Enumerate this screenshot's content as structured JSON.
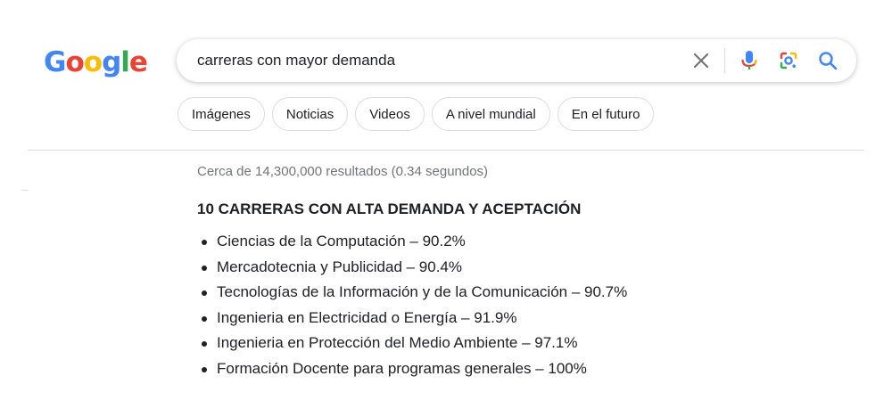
{
  "logo": {
    "letters": [
      {
        "char": "G",
        "color": "#4285F4"
      },
      {
        "char": "o",
        "color": "#EA4335"
      },
      {
        "char": "o",
        "color": "#FBBC05"
      },
      {
        "char": "g",
        "color": "#4285F4"
      },
      {
        "char": "l",
        "color": "#34A853"
      },
      {
        "char": "e",
        "color": "#EA4335"
      }
    ]
  },
  "search": {
    "query": "carreras con mayor demanda",
    "icons": {
      "clear": "close-icon",
      "voice": "microphone-icon",
      "lens": "google-lens-icon",
      "submit": "search-icon"
    }
  },
  "filters": {
    "chips": [
      "Imágenes",
      "Noticias",
      "Videos",
      "A nivel mundial",
      "En el futuro"
    ]
  },
  "results": {
    "stats": "Cerca de 14,300,000 resultados (0.34 segundos)",
    "snippet": {
      "title": "10 CARRERAS CON ALTA DEMANDA Y ACEPTACIÓN",
      "items": [
        "Ciencias de la Computación – 90.2%",
        "Mercadotecnia y Publicidad – 90.4%",
        "Tecnologías de la Información y de la Comunicación – 90.7%",
        "Ingenieria en Electricidad o Energía – 91.9%",
        "Ingenieria en Protección del Medio Ambiente – 97.1%",
        "Formación Docente para programas generales – 100%"
      ]
    }
  },
  "colors": {
    "google_blue": "#4285F4",
    "google_red": "#EA4335",
    "google_yellow": "#FBBC05",
    "google_green": "#34A853",
    "text": "#202124",
    "secondary_text": "#70757a",
    "border": "#dadce0"
  }
}
